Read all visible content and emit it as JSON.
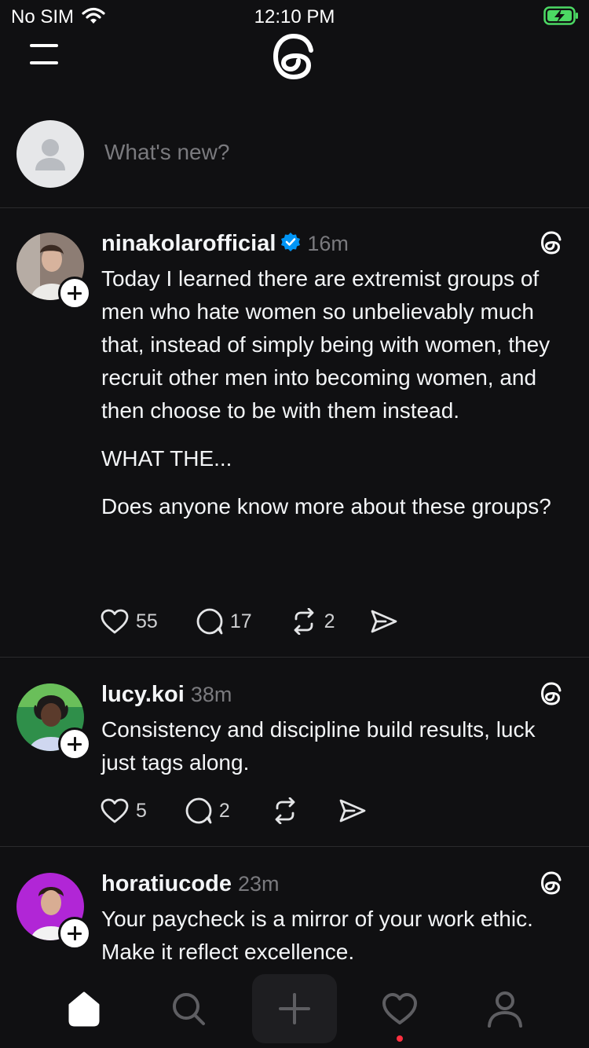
{
  "status_bar": {
    "carrier": "No SIM",
    "time": "12:10 PM"
  },
  "composer": {
    "placeholder": "What's new?"
  },
  "posts": [
    {
      "username": "ninakolarofficial",
      "verified": true,
      "time": "16m",
      "paragraphs": [
        "Today I learned there are extremist groups of men who hate women so unbelievably much that, instead of simply being with women, they recruit other men into becoming women, and then choose to be with them instead.",
        "WHAT THE...",
        "Does anyone know more about these groups?"
      ],
      "likes": "55",
      "replies": "17",
      "reposts": "2"
    },
    {
      "username": "lucy.koi",
      "verified": false,
      "time": "38m",
      "paragraphs": [
        "Consistency and discipline build results, luck just tags along."
      ],
      "likes": "5",
      "replies": "2",
      "reposts": ""
    },
    {
      "username": "horatiucode",
      "verified": false,
      "time": "23m",
      "paragraphs": [
        "Your paycheck is a mirror of your work ethic. Make it reflect excellence."
      ]
    }
  ],
  "tabbar": {
    "items": [
      "home-icon",
      "search-icon",
      "create-icon",
      "activity-icon",
      "profile-icon"
    ],
    "active": "home",
    "has_notification": true
  },
  "colors": {
    "background": "#101012",
    "text": "#f3f5f7",
    "muted": "#7a7a7e",
    "verified": "#0095f6",
    "notification": "#ff3040",
    "battery": "#4cd964"
  }
}
